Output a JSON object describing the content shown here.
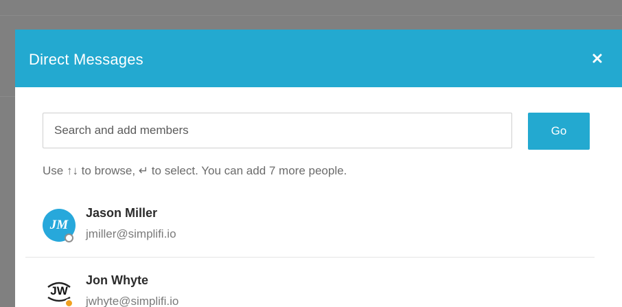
{
  "modal": {
    "title": "Direct Messages",
    "close_icon": "close-icon"
  },
  "search": {
    "placeholder": "Search and add members",
    "value": "",
    "go_label": "Go"
  },
  "hint": "Use ↑↓ to browse, ↵ to select. You can add 7 more people.",
  "members": [
    {
      "name": "Jason Miller",
      "email": "jmiller@simplifi.io",
      "initials": "JM",
      "status": "offline"
    },
    {
      "name": "Jon Whyte",
      "email": "jwhyte@simplifi.io",
      "initials": "JW",
      "status": "away"
    }
  ],
  "colors": {
    "accent": "#23a9d0",
    "away": "#f0a020",
    "backdrop": "#808080"
  }
}
